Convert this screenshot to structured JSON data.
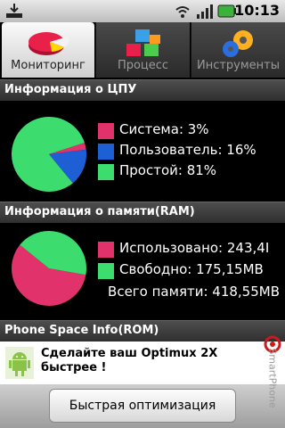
{
  "status_bar": {
    "time": "10:13"
  },
  "tabs": [
    {
      "label": "Мониторинг",
      "icon": "pie-chart-icon",
      "active": true
    },
    {
      "label": "Процесс",
      "icon": "cubes-icon",
      "active": false
    },
    {
      "label": "Инструменты",
      "icon": "gears-icon",
      "active": false
    }
  ],
  "cpu": {
    "title": "Информация о ЦПУ",
    "legend": [
      {
        "label": "Система: 3%",
        "color": "#e2326b",
        "percent": 3
      },
      {
        "label": "Пользователь: 16%",
        "color": "#1e5fd6",
        "percent": 16
      },
      {
        "label": "Простой: 81%",
        "color": "#3ddc6e",
        "percent": 81
      }
    ]
  },
  "ram": {
    "title": "Информация о памяти(RAM)",
    "legend": [
      {
        "label": "Использовано: 243,4I",
        "color": "#e2326b",
        "percent": 58
      },
      {
        "label": "Свободно: 175,15MB",
        "color": "#3ddc6e",
        "percent": 42
      }
    ],
    "total": "Всего памяти: 418,55MB"
  },
  "rom": {
    "title": "Phone Space Info(ROM)"
  },
  "ad": {
    "text": "Сделайте ваш Optimux 2X быстрее !"
  },
  "bottom": {
    "button": "Быстрая оптимизация"
  },
  "watermark": {
    "text": "SmartPhone"
  }
}
